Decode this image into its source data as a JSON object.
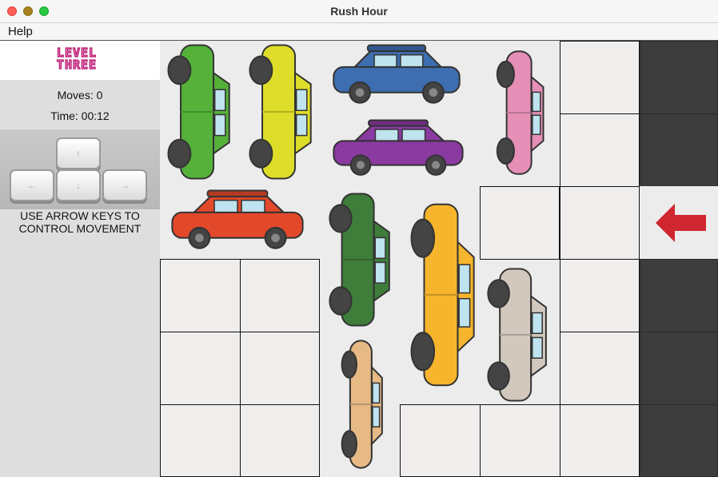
{
  "window": {
    "title": "Rush Hour"
  },
  "menu": {
    "items": [
      "Help"
    ]
  },
  "sidebar": {
    "logo": {
      "line1": "LEVEL",
      "line2": "THREE"
    },
    "moves": "Moves: 0",
    "time": "Time: 00:12",
    "keys": [
      "up-arrow",
      "left-arrow",
      "down-arrow",
      "right-arrow"
    ],
    "instructions_line1": "USE ARROW KEYS TO",
    "instructions_line2": "CONTROL MOVEMENT"
  },
  "board": {
    "exit_arrow_color": "#d0262f",
    "cars": [
      {
        "name": "green-car",
        "color": "#55b13a",
        "orientation": "vertical"
      },
      {
        "name": "yellow-car",
        "color": "#dede2a",
        "orientation": "vertical"
      },
      {
        "name": "blue-car",
        "color": "#3e6db0",
        "orientation": "horizontal"
      },
      {
        "name": "purple-car",
        "color": "#8a3aa0",
        "orientation": "horizontal"
      },
      {
        "name": "pink-car",
        "color": "#e58fb6",
        "orientation": "vertical"
      },
      {
        "name": "red-car",
        "color": "#e2482a",
        "orientation": "horizontal"
      },
      {
        "name": "dark-green-car",
        "color": "#3f7d3a",
        "orientation": "vertical"
      },
      {
        "name": "orange-car",
        "color": "#f6b52c",
        "orientation": "vertical"
      },
      {
        "name": "silver-car",
        "color": "#d3c8bd",
        "orientation": "vertical"
      },
      {
        "name": "tan-car",
        "color": "#e6b985",
        "orientation": "vertical"
      }
    ]
  }
}
